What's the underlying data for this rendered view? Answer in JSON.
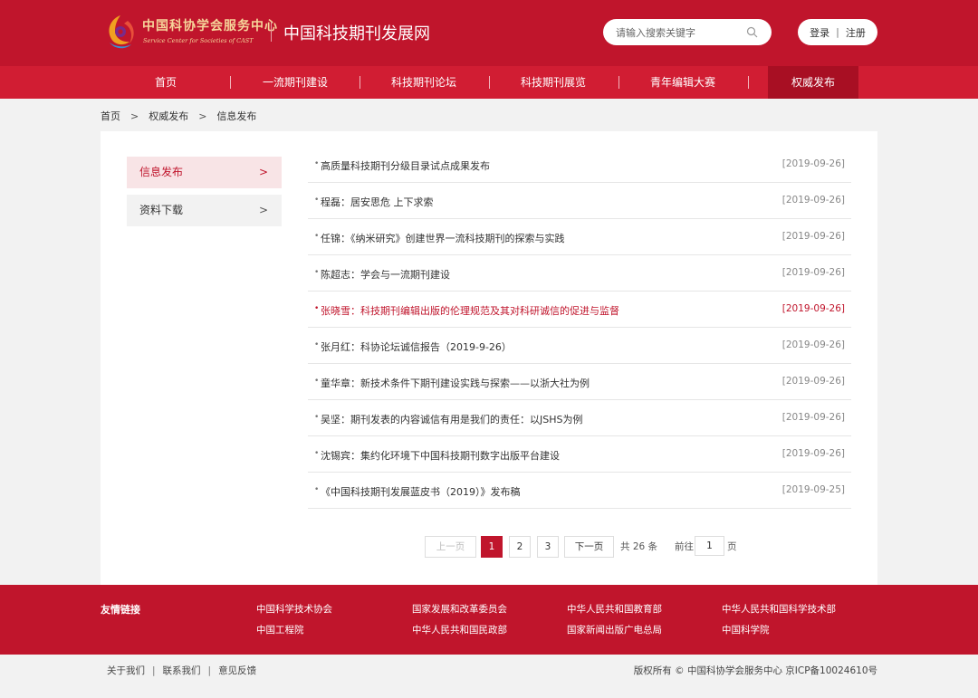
{
  "header": {
    "logo_text": "中国科协学会服务中心",
    "logo_subtext": "Service Center for Societies of CAST",
    "site_title": "中国科技期刊发展网",
    "search_placeholder": "请输入搜索关键字",
    "login_label": "登录",
    "auth_separator": "|",
    "register_label": "注册",
    "colors": {
      "primary": "#c0152c",
      "nav": "#d11d33",
      "nav_active": "#a80f23",
      "logo_gold": "#f6d59a"
    }
  },
  "nav": {
    "separator": "|",
    "items": [
      {
        "label": "首页"
      },
      {
        "label": "一流期刊建设"
      },
      {
        "label": "科技期刊论坛"
      },
      {
        "label": "科技期刊展览"
      },
      {
        "label": "青年编辑大赛"
      },
      {
        "label": "权威发布"
      }
    ]
  },
  "breadcrumb": {
    "arrow": ">",
    "items": [
      "首页",
      "权威发布",
      "信息发布"
    ]
  },
  "sidebar": {
    "chevron": ">",
    "items": [
      {
        "label": "信息发布",
        "active": true
      },
      {
        "label": "资料下载",
        "active": false
      }
    ]
  },
  "list": {
    "bullet": "•",
    "items": [
      {
        "title": "高质量科技期刊分级目录试点成果发布",
        "date": "[2019-09-26]"
      },
      {
        "title": "程磊：居安思危 上下求索",
        "date": "[2019-09-26]"
      },
      {
        "title": "任锦：《纳米研究》创建世界一流科技期刊的探索与实践",
        "date": "[2019-09-26]"
      },
      {
        "title": "陈超志：学会与一流期刊建设",
        "date": "[2019-09-26]"
      },
      {
        "title": "张晓雪：科技期刊编辑出版的伦理规范及其对科研诚信的促进与监督",
        "date": "[2019-09-26]",
        "highlight": true
      },
      {
        "title": "张月红：科协论坛诚信报告（2019-9-26）",
        "date": "[2019-09-26]"
      },
      {
        "title": "童华章：新技术条件下期刊建设实践与探索——以浙大社为例",
        "date": "[2019-09-26]"
      },
      {
        "title": "吴坚：期刊发表的内容诚信有用是我们的责任：以JSHS为例",
        "date": "[2019-09-26]"
      },
      {
        "title": "沈锡宾：集约化环境下中国科技期刊数字出版平台建设",
        "date": "[2019-09-26]"
      },
      {
        "title": "《中国科技期刊发展蓝皮书（2019）》发布稿",
        "date": "[2019-09-25]"
      }
    ]
  },
  "pagination": {
    "prev_label": "上一页",
    "pages": [
      "1",
      "2",
      "3"
    ],
    "current_page": "1",
    "next_label": "下一页",
    "total_text": "共 26 条",
    "goto_label": "前往",
    "goto_value": "1",
    "page_suffix": "页"
  },
  "footer": {
    "links_label": "友情链接",
    "links": [
      "中国科学技术协会",
      "国家发展和改革委员会",
      "中华人民共和国教育部",
      "中华人民共和国科学技术部",
      "中国工程院",
      "中华人民共和国民政部",
      "国家新闻出版广电总局",
      "中国科学院"
    ]
  },
  "bottom": {
    "separator": "|",
    "links": [
      "关于我们",
      "联系我们",
      "意见反馈"
    ],
    "copyright": "版权所有 © 中国科协学会服务中心 京ICP备10024610号"
  }
}
